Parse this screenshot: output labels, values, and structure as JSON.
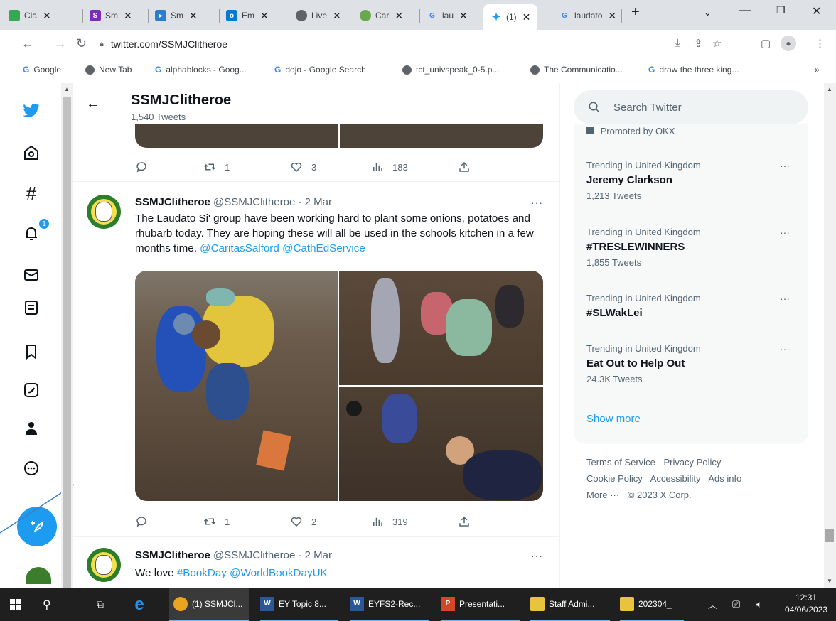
{
  "browser": {
    "tabs": [
      {
        "label": "Cla",
        "color": "#34a853"
      },
      {
        "label": "Sm",
        "color": "#7b2cbf"
      },
      {
        "label": "Sm",
        "color": "#2b7cd3"
      },
      {
        "label": "Em",
        "color": "#0078d4"
      },
      {
        "label": "Live",
        "color": "#5f6368"
      },
      {
        "label": "Car",
        "color": "#6aa84f"
      },
      {
        "label": "lau",
        "color": "#4285f4"
      },
      {
        "label": "(1)",
        "color": "#1d9bf0"
      },
      {
        "label": "laudato",
        "color": "#4285f4"
      }
    ],
    "new_tab": "+",
    "url": "twitter.com/SSMJClitheroe",
    "bookmarks": [
      {
        "label": "Google",
        "type": "g"
      },
      {
        "label": "New Tab",
        "type": "globe"
      },
      {
        "label": "alphablocks - Goog...",
        "type": "g"
      },
      {
        "label": "dojo - Google Search",
        "type": "g"
      },
      {
        "label": "tct_univspeak_0-5.p...",
        "type": "globe"
      },
      {
        "label": "The Communicatio...",
        "type": "globe"
      },
      {
        "label": "draw the three king...",
        "type": "g"
      }
    ],
    "bookmarks_overflow": "»"
  },
  "header": {
    "title": "SSMJClitheroe",
    "subtitle": "1,540 Tweets"
  },
  "nav": {
    "notification_count": "1"
  },
  "tweets": [
    {
      "replies": "",
      "retweets": "1",
      "likes": "3",
      "views": "183"
    },
    {
      "name": "SSMJClitheroe",
      "handle": "@SSMJClitheroe · 2 Mar",
      "text": "The Laudato Si' group have been working hard to plant some onions, potatoes and rhubarb today. They are hoping these will all be used in the schools kitchen in a few months time.",
      "mention1": "@CaritasSalford",
      "mention2": "@CathEdService",
      "replies": "",
      "retweets": "1",
      "likes": "2",
      "views": "319"
    },
    {
      "name": "SSMJClitheroe",
      "handle": "@SSMJClitheroe · 2 Mar",
      "text": "We love",
      "tag": "#BookDay",
      "mention": "@WorldBookDayUK"
    }
  ],
  "sidebar": {
    "search_placeholder": "Search Twitter",
    "promoted": "Promoted by OKX",
    "trends": [
      {
        "context": "Trending in United Kingdom",
        "name": "Jeremy Clarkson",
        "count": "1,213 Tweets"
      },
      {
        "context": "Trending in United Kingdom",
        "name": "#TRESLEWINNERS",
        "count": "1,855 Tweets"
      },
      {
        "context": "Trending in United Kingdom",
        "name": "#SLWakLei",
        "count": ""
      },
      {
        "context": "Trending in United Kingdom",
        "name": "Eat Out to Help Out",
        "count": "24.3K Tweets"
      }
    ],
    "show_more": "Show more",
    "footer": {
      "terms": "Terms of Service",
      "privacy": "Privacy Policy",
      "cookie": "Cookie Policy",
      "accessibility": "Accessibility",
      "ads": "Ads info",
      "more": "More ···",
      "copyright": "© 2023 X Corp."
    }
  },
  "taskbar": {
    "items": [
      {
        "label": "(1) SSMJCl...",
        "icon": "chrome"
      },
      {
        "label": "EY Topic 8...",
        "icon": "word"
      },
      {
        "label": "EYFS2-Rec...",
        "icon": "word"
      },
      {
        "label": "Presentati...",
        "icon": "powerpoint"
      },
      {
        "label": "Staff Admi...",
        "icon": "folder-green"
      },
      {
        "label": "202304_",
        "icon": "folder"
      }
    ],
    "time": "12:31",
    "date": "04/06/2023"
  },
  "colors": {
    "twitter_blue": "#1d9bf0",
    "text_secondary": "#536471",
    "taskbar": "#1f1f1f"
  }
}
